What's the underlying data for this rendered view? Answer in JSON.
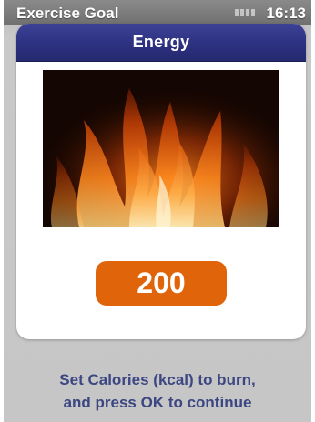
{
  "status_bar": {
    "title": "Exercise Goal",
    "time": "16:13",
    "icons": [
      "signal-icon"
    ]
  },
  "dialog": {
    "title": "Energy",
    "image": "fire-image",
    "value": "200"
  },
  "instruction": {
    "line1": "Set Calories (kcal) to burn,",
    "line2": "and press OK to continue"
  },
  "colors": {
    "header": "#2d3180",
    "value_box": "#e06409",
    "instruction_text": "#3c4682",
    "background": "#c6c6c6"
  }
}
